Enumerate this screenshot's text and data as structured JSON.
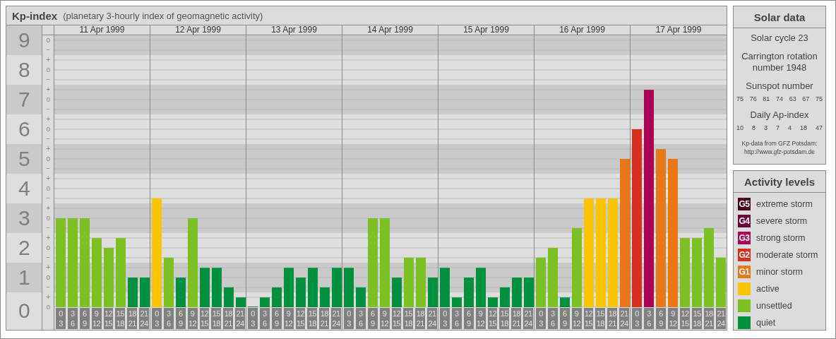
{
  "chart_panel": {
    "title": "Kp-index",
    "subtitle": "(planetary 3-hourly index of geomagnetic activity)",
    "y_levels": [
      {
        "marks": [
          "o",
          "−"
        ]
      },
      {
        "marks": [
          "+",
          "o",
          "−"
        ]
      },
      {
        "marks": [
          "+",
          "o",
          "−"
        ]
      },
      {
        "marks": [
          "+",
          "o",
          "−"
        ]
      },
      {
        "marks": [
          "+",
          "o",
          "−"
        ]
      },
      {
        "marks": [
          "+",
          "o",
          "−"
        ]
      },
      {
        "marks": [
          "+",
          "o",
          "−"
        ]
      },
      {
        "marks": [
          "+",
          "o",
          "−"
        ]
      },
      {
        "marks": [
          "+",
          "o",
          "−"
        ]
      },
      {
        "marks": [
          "+",
          "o"
        ]
      }
    ],
    "days": [
      {
        "date": "11 Apr 1999",
        "slots": [
          {
            "from": "0",
            "to": "3",
            "color": "#7dc022"
          },
          {
            "from": "3",
            "to": "6",
            "color": "#7dc022"
          },
          {
            "from": "6",
            "to": "9",
            "color": "#7dc022"
          },
          {
            "from": "9",
            "to": "12",
            "color": "#7dc022"
          },
          {
            "from": "12",
            "to": "15",
            "color": "#7dc022"
          },
          {
            "from": "15",
            "to": "18",
            "color": "#7dc022"
          },
          {
            "from": "18",
            "to": "21",
            "color": "#00913f"
          },
          {
            "from": "21",
            "to": "24",
            "color": "#00913f"
          }
        ]
      },
      {
        "date": "12 Apr 1999",
        "slots": [
          {
            "from": "0",
            "to": "3",
            "color": "#f9c500"
          },
          {
            "from": "3",
            "to": "6",
            "color": "#7dc022"
          },
          {
            "from": "6",
            "to": "9",
            "color": "#00913f"
          },
          {
            "from": "9",
            "to": "12",
            "color": "#7dc022"
          },
          {
            "from": "12",
            "to": "15",
            "color": "#00913f"
          },
          {
            "from": "15",
            "to": "18",
            "color": "#00913f"
          },
          {
            "from": "18",
            "to": "21",
            "color": "#00913f"
          },
          {
            "from": "21",
            "to": "24",
            "color": "#00913f"
          }
        ]
      },
      {
        "date": "13 Apr 1999",
        "slots": [
          {
            "from": "0",
            "to": "3",
            "color": "#00913f"
          },
          {
            "from": "3",
            "to": "6",
            "color": "#00913f"
          },
          {
            "from": "6",
            "to": "9",
            "color": "#00913f"
          },
          {
            "from": "9",
            "to": "12",
            "color": "#00913f"
          },
          {
            "from": "12",
            "to": "15",
            "color": "#00913f"
          },
          {
            "from": "15",
            "to": "18",
            "color": "#00913f"
          },
          {
            "from": "18",
            "to": "21",
            "color": "#00913f"
          },
          {
            "from": "21",
            "to": "24",
            "color": "#00913f"
          }
        ]
      },
      {
        "date": "14 Apr 1999",
        "slots": [
          {
            "from": "0",
            "to": "3",
            "color": "#00913f"
          },
          {
            "from": "3",
            "to": "6",
            "color": "#00913f"
          },
          {
            "from": "6",
            "to": "9",
            "color": "#7dc022"
          },
          {
            "from": "9",
            "to": "12",
            "color": "#7dc022"
          },
          {
            "from": "12",
            "to": "15",
            "color": "#00913f"
          },
          {
            "from": "15",
            "to": "18",
            "color": "#7dc022"
          },
          {
            "from": "18",
            "to": "21",
            "color": "#7dc022"
          },
          {
            "from": "21",
            "to": "24",
            "color": "#00913f"
          }
        ]
      },
      {
        "date": "15 Apr 1999",
        "slots": [
          {
            "from": "0",
            "to": "3",
            "color": "#00913f"
          },
          {
            "from": "3",
            "to": "6",
            "color": "#00913f"
          },
          {
            "from": "6",
            "to": "9",
            "color": "#00913f"
          },
          {
            "from": "9",
            "to": "12",
            "color": "#00913f"
          },
          {
            "from": "12",
            "to": "15",
            "color": "#00913f"
          },
          {
            "from": "15",
            "to": "18",
            "color": "#00913f"
          },
          {
            "from": "18",
            "to": "21",
            "color": "#00913f"
          },
          {
            "from": "21",
            "to": "24",
            "color": "#00913f"
          }
        ]
      },
      {
        "date": "16 Apr 1999",
        "slots": [
          {
            "from": "0",
            "to": "3",
            "color": "#7dc022"
          },
          {
            "from": "3",
            "to": "6",
            "color": "#7dc022"
          },
          {
            "from": "6",
            "to": "9",
            "color": "#00913f"
          },
          {
            "from": "9",
            "to": "12",
            "color": "#7dc022"
          },
          {
            "from": "12",
            "to": "15",
            "color": "#f9c500"
          },
          {
            "from": "15",
            "to": "18",
            "color": "#f9c500"
          },
          {
            "from": "18",
            "to": "21",
            "color": "#f9c500"
          },
          {
            "from": "21",
            "to": "24",
            "color": "#e87817"
          }
        ]
      },
      {
        "date": "17 Apr 1999",
        "slots": [
          {
            "from": "0",
            "to": "3",
            "color": "#d9301e"
          },
          {
            "from": "3",
            "to": "6",
            "color": "#aa0055"
          },
          {
            "from": "6",
            "to": "9",
            "color": "#e87817"
          },
          {
            "from": "9",
            "to": "12",
            "color": "#e87817"
          },
          {
            "from": "12",
            "to": "15",
            "color": "#7dc022"
          },
          {
            "from": "15",
            "to": "18",
            "color": "#7dc022"
          },
          {
            "from": "18",
            "to": "21",
            "color": "#7dc022"
          },
          {
            "from": "21",
            "to": "24",
            "color": "#7dc022"
          }
        ]
      }
    ],
    "chart_data": {
      "type": "bar",
      "ylim": [
        0,
        9
      ],
      "yticks": [
        0,
        1,
        2,
        3,
        4,
        5,
        6,
        7,
        8,
        9
      ],
      "grid": true,
      "values": [
        3,
        3,
        3,
        2.33,
        2,
        2.33,
        1,
        1,
        3.67,
        1.67,
        1,
        3,
        1.33,
        1.33,
        0.67,
        0.33,
        0,
        0.33,
        0.67,
        1.33,
        1,
        1.33,
        0.67,
        1.33,
        1.33,
        0.67,
        3,
        3,
        1,
        1.67,
        1.67,
        1,
        1.33,
        0.33,
        1,
        1.33,
        0.33,
        0.67,
        1,
        1,
        1.67,
        2,
        0.33,
        2.67,
        3.67,
        3.67,
        3.67,
        5,
        6,
        7.33,
        5.33,
        5,
        2.33,
        2.33,
        2.67,
        1.67
      ]
    }
  },
  "solar_data": {
    "title": "Solar data",
    "cycle": "Solar cycle 23",
    "rotation": "Carrington rotation number 1948",
    "sunspot_title": "Sunspot number",
    "sunspot_values": [
      "75",
      "76",
      "81",
      "74",
      "63",
      "67",
      "75"
    ],
    "ap_title": "Daily Ap-index",
    "ap_values": [
      "10",
      "8",
      "3",
      "7",
      "4",
      "18",
      "47"
    ],
    "credit": [
      "Kp-data from GFZ Potsdam:",
      "http://www.gfz-potsdam.de"
    ]
  },
  "activity_levels": {
    "title": "Activity levels",
    "items": [
      {
        "kind": "badge",
        "badge": "G5",
        "label": "extreme storm",
        "color": "#4a0022"
      },
      {
        "kind": "badge",
        "badge": "G4",
        "label": "severe storm",
        "color": "#6e0038"
      },
      {
        "kind": "badge",
        "badge": "G3",
        "label": "strong storm",
        "color": "#aa0055"
      },
      {
        "kind": "badge",
        "badge": "G2",
        "label": "moderate storm",
        "color": "#d9301e"
      },
      {
        "kind": "badge",
        "badge": "G1",
        "label": "minor storm",
        "color": "#e87817"
      },
      {
        "kind": "swatch",
        "label": "active",
        "color": "#f9c500"
      },
      {
        "kind": "swatch",
        "label": "unsettled",
        "color": "#7dc022"
      },
      {
        "kind": "swatch",
        "label": "quiet",
        "color": "#00913f"
      }
    ]
  }
}
